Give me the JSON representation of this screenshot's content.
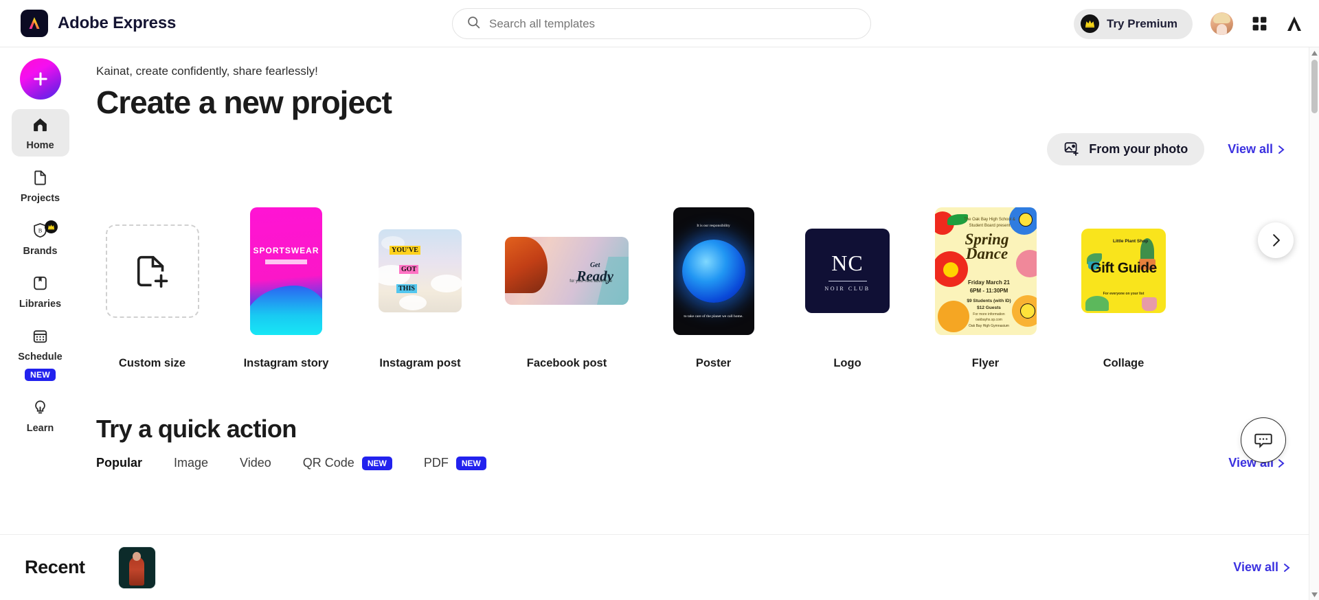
{
  "header": {
    "brand_name": "Adobe Express",
    "brand_logo_icon": "adobe-express-logo",
    "search": {
      "placeholder": "Search all templates",
      "value": "",
      "icon": "search-icon"
    },
    "premium": {
      "label": "Try Premium",
      "icon": "crown-icon"
    },
    "avatar_icon": "user-avatar",
    "apps_icon": "app-grid-icon",
    "adobe_icon": "adobe-logo-icon"
  },
  "sidebar": {
    "new_button_icon": "plus-icon",
    "items": [
      {
        "label": "Home",
        "icon": "home-icon",
        "active": true
      },
      {
        "label": "Projects",
        "icon": "document-icon",
        "active": false
      },
      {
        "label": "Brands",
        "icon": "brand-shield-icon",
        "badge": "crown",
        "active": false
      },
      {
        "label": "Libraries",
        "icon": "library-icon",
        "active": false
      },
      {
        "label": "Schedule",
        "icon": "calendar-icon",
        "badge_text": "NEW",
        "active": false
      },
      {
        "label": "Learn",
        "icon": "lightbulb-icon",
        "active": false
      }
    ]
  },
  "main": {
    "greeting": "Kainat, create confidently, share fearlessly!",
    "title": "Create a new project",
    "from_photo_label": "From your photo",
    "from_photo_icon": "image-plus-icon",
    "view_all_label": "View all",
    "next_arrow_icon": "chevron-right-icon",
    "templates": [
      {
        "label": "Custom size",
        "kind": "custom",
        "icon": "document-plus-icon"
      },
      {
        "label": "Instagram story",
        "kind": "story",
        "title": "SPORTSWEAR"
      },
      {
        "label": "Instagram post",
        "kind": "igpost",
        "words": [
          "YOU'VE",
          "GOT",
          "THIS"
        ]
      },
      {
        "label": "Facebook post",
        "kind": "facebook",
        "title_small": "Get",
        "title_big": "Ready",
        "subtitle": "for your next adventure"
      },
      {
        "label": "Poster",
        "kind": "poster",
        "top_text": "It is our responsibility",
        "bottom_text": "to take care of the planet we call home."
      },
      {
        "label": "Logo",
        "kind": "logo",
        "mark": "NC",
        "sub": "NOIR CLUB"
      },
      {
        "label": "Flyer",
        "kind": "flyer",
        "presented_by": "The Oak Bay High School & Student Board present",
        "title": "Spring Dance",
        "when": "Friday March 21\n6PM - 11:30PM",
        "prices": "$9 Students (with ID)\n$12 Guests",
        "info": "For more information\noakbayhs.sp.com",
        "venue": "Oak Bay High Gymnasium"
      },
      {
        "label": "Collage",
        "kind": "collage",
        "brand": "Little Plant Shop",
        "title": "Gift Guide",
        "sub": "For everyone on your list"
      }
    ]
  },
  "quick_action": {
    "title": "Try a quick action",
    "view_all_label": "View all",
    "tabs": [
      {
        "label": "Popular",
        "active": true
      },
      {
        "label": "Image",
        "active": false
      },
      {
        "label": "Video",
        "active": false
      },
      {
        "label": "QR Code",
        "badge": "NEW",
        "active": false
      },
      {
        "label": "PDF",
        "badge": "NEW",
        "active": false
      }
    ]
  },
  "recent": {
    "title": "Recent",
    "view_all_label": "View all",
    "items": [
      {
        "name": "recent-project-thumbnail"
      }
    ]
  },
  "chat": {
    "icon": "chat-bubble-icon"
  },
  "colors": {
    "accent_blue": "#3b31e0",
    "badge_blue": "#2222ee",
    "sidebar_active": "#eaeaea"
  }
}
